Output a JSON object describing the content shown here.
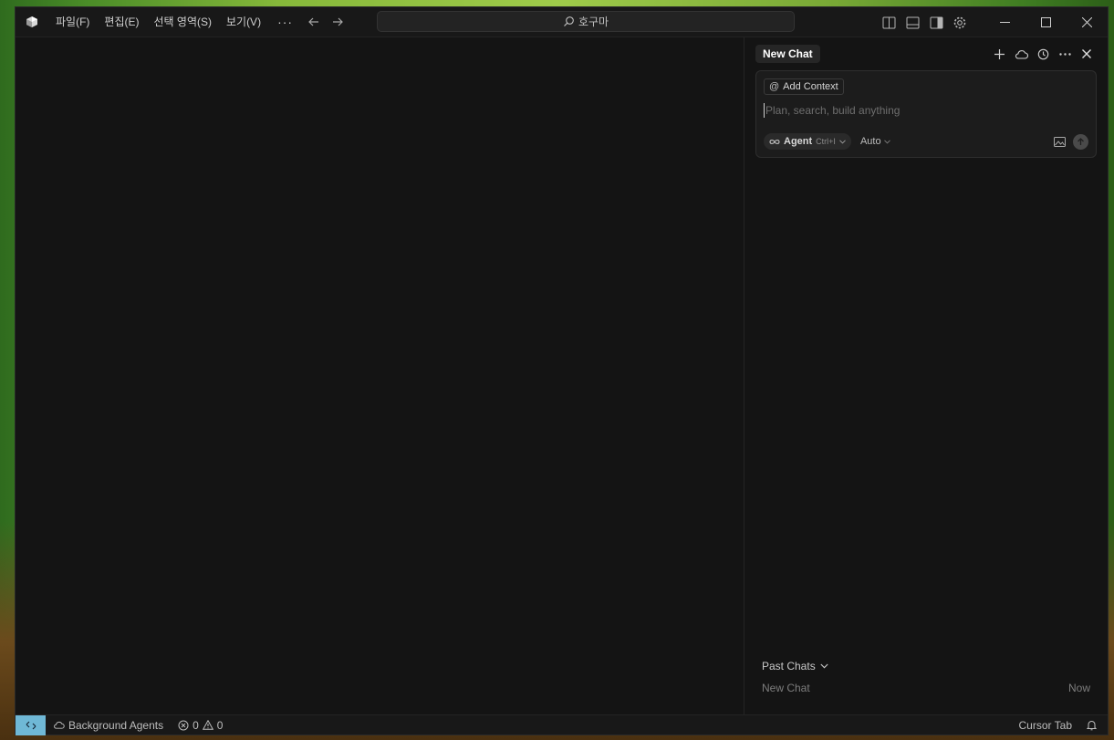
{
  "window": {
    "menu": [
      "파일(F)",
      "편집(E)",
      "선택 영역(S)",
      "보기(V)"
    ],
    "menu_more": "···",
    "search_text": "호구마"
  },
  "chat": {
    "tab_label": "New Chat",
    "add_context_label": "Add Context",
    "input_placeholder": "Plan, search, build anything",
    "agent_label": "Agent",
    "agent_shortcut": "Ctrl+I",
    "model_label": "Auto",
    "past_chats_label": "Past Chats",
    "past_chats": [
      {
        "title": "New Chat",
        "time": "Now"
      }
    ]
  },
  "statusbar": {
    "background_agents": "Background Agents",
    "errors": "0",
    "warnings": "0",
    "cursor_tab": "Cursor Tab"
  },
  "colors": {
    "remote_accent": "#6fb8d6",
    "window_bg": "#141414"
  }
}
